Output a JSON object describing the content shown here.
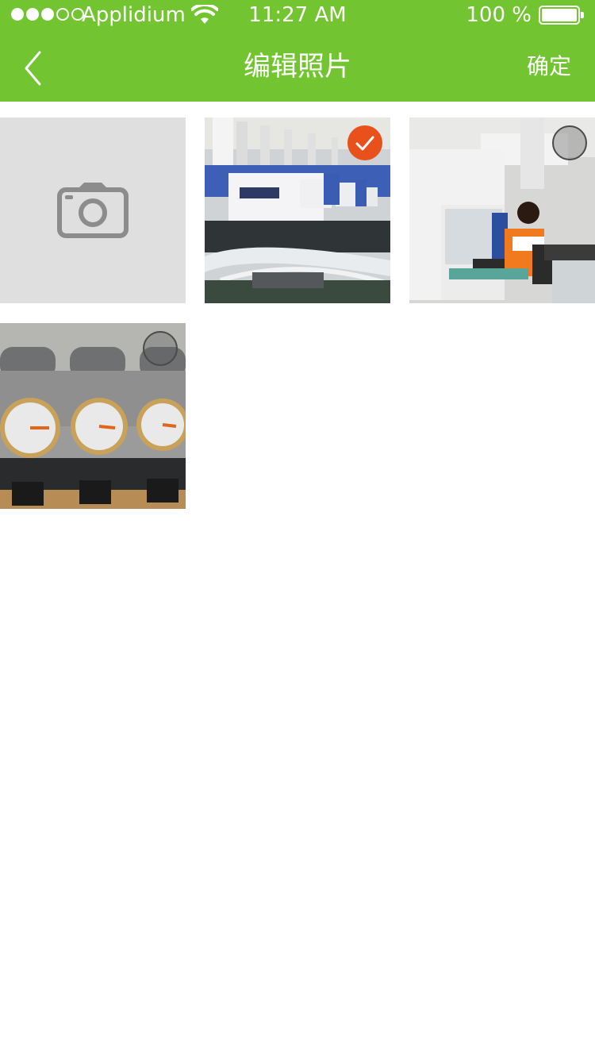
{
  "status_bar": {
    "carrier": "Applidium",
    "time": "11:27 AM",
    "battery_percent": "100 %",
    "signal_bars_filled": 3,
    "signal_bars_total": 5
  },
  "nav": {
    "title": "编辑照片",
    "confirm_label": "确定",
    "back_icon": "chevron-left-icon"
  },
  "grid": {
    "camera_icon": "camera-icon",
    "photos": [
      {
        "subject": "injection molding machines",
        "selected": true
      },
      {
        "subject": "worker at machine",
        "selected": false
      },
      {
        "subject": "pressure gauges",
        "selected": false
      }
    ]
  },
  "colors": {
    "header_bg": "#72c531",
    "selected_badge": "#e8511b",
    "camera_tile_bg": "#dfdfdf"
  }
}
